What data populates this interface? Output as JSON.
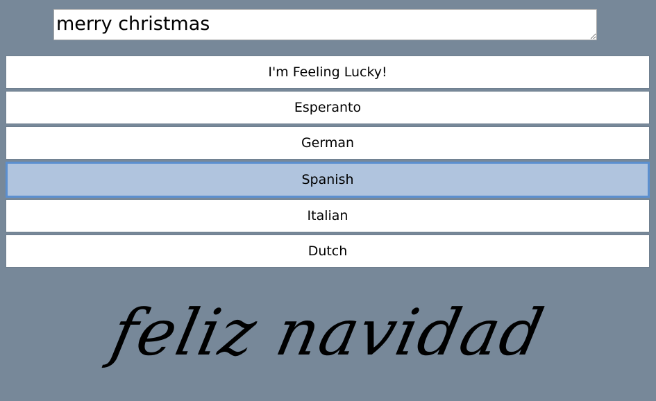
{
  "input": {
    "value": "merry christmas"
  },
  "languages": [
    {
      "label": "I'm Feeling Lucky!",
      "active": false
    },
    {
      "label": "Esperanto",
      "active": false
    },
    {
      "label": "German",
      "active": false
    },
    {
      "label": "Spanish",
      "active": true
    },
    {
      "label": "Italian",
      "active": false
    },
    {
      "label": "Dutch",
      "active": false
    }
  ],
  "output": {
    "translation": "feliz navidad"
  },
  "colors": {
    "background": "#778899",
    "button_bg": "#ffffff",
    "active_bg": "#b0c4de",
    "active_border": "#5b8fcf"
  }
}
